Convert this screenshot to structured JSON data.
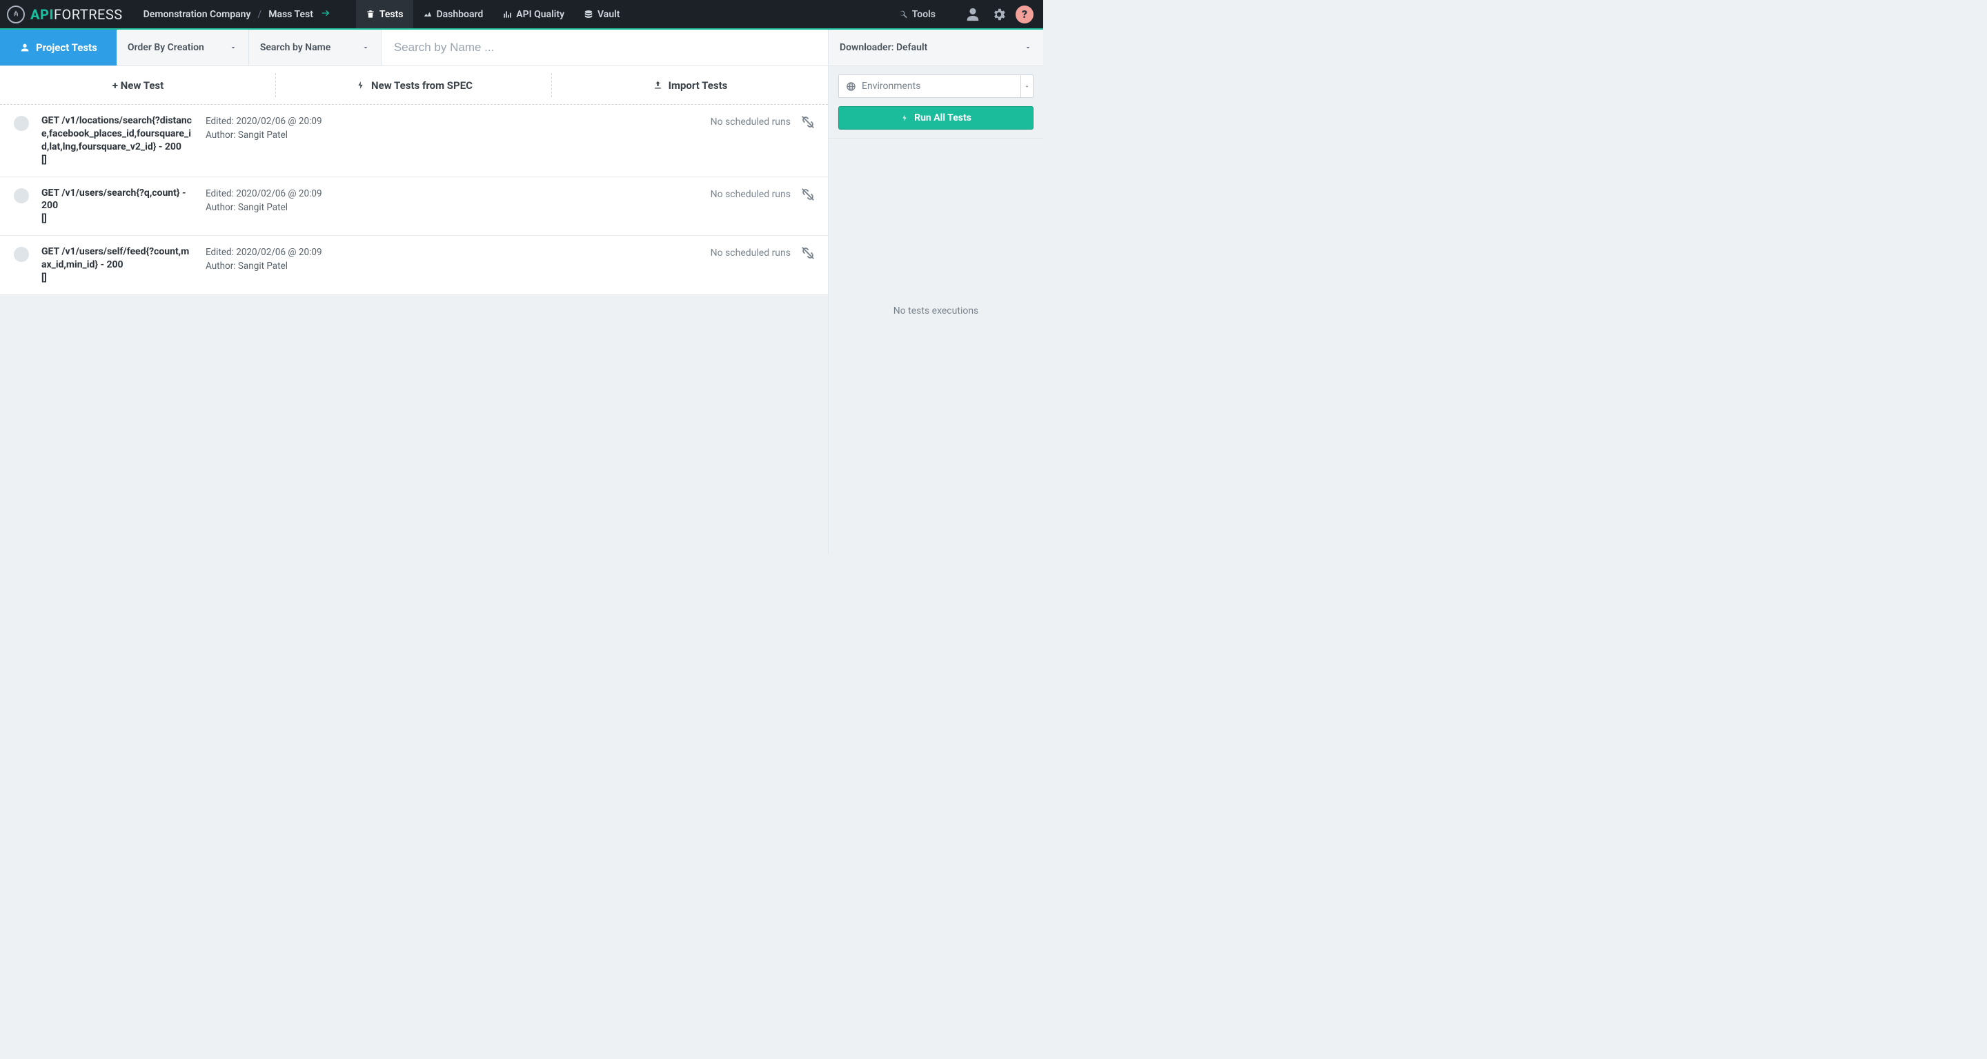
{
  "brand": {
    "api": "API",
    "fortress": "FORTRESS"
  },
  "breadcrumb": {
    "company": "Demonstration Company",
    "project": "Mass Test"
  },
  "nav": {
    "tests": "Tests",
    "dashboard": "Dashboard",
    "apiquality": "API Quality",
    "vault": "Vault",
    "tools": "Tools"
  },
  "subbar": {
    "project_tests": "Project Tests",
    "order": "Order By Creation",
    "searchby": "Search by Name",
    "search_placeholder": "Search by Name ...",
    "downloader": "Downloader: Default"
  },
  "actions": {
    "new_test": "+ New Test",
    "from_spec": "New Tests from SPEC",
    "import": "Import Tests"
  },
  "rightcol": {
    "environments": "Environments",
    "run_all": "Run All Tests",
    "no_exec": "No tests executions"
  },
  "common": {
    "no_scheduled": "No scheduled runs",
    "bracket": "[]"
  },
  "tests": [
    {
      "name": "GET /v1/locations/search{?distance,facebook_places_id,foursquare_id,lat,lng,foursquare_v2_id} - 200",
      "edited": "Edited: 2020/02/06 @ 20:09",
      "author": "Author: Sangit Patel"
    },
    {
      "name": "GET /v1/users/search{?q,count} - 200",
      "edited": "Edited: 2020/02/06 @ 20:09",
      "author": "Author: Sangit Patel"
    },
    {
      "name": "GET /v1/users/self/feed{?count,max_id,min_id} - 200",
      "edited": "Edited: 2020/02/06 @ 20:09",
      "author": "Author: Sangit Patel"
    }
  ]
}
